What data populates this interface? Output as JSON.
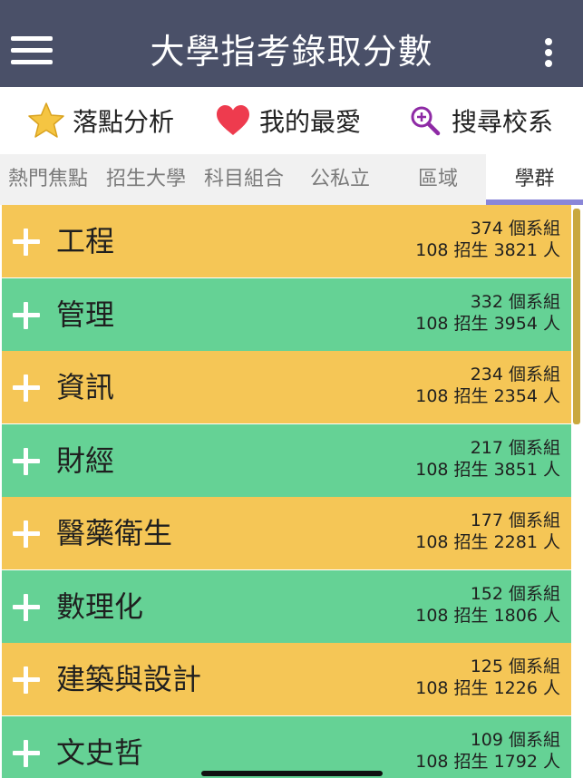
{
  "header": {
    "title": "大學指考錄取分數",
    "menu_icon": "hamburger-icon",
    "more_icon": "kebab-icon"
  },
  "actions": [
    {
      "label": "落點分析",
      "icon": "star-icon"
    },
    {
      "label": "我的最愛",
      "icon": "heart-icon"
    },
    {
      "label": "搜尋校系",
      "icon": "magnifier-plus-icon"
    }
  ],
  "tabs": [
    {
      "label": "熱門焦點"
    },
    {
      "label": "招生大學"
    },
    {
      "label": "科目組合"
    },
    {
      "label": "公私立"
    },
    {
      "label": "區域"
    },
    {
      "label": "學群",
      "active": true
    }
  ],
  "groups": [
    {
      "name": "工程",
      "departments": "374 個系組",
      "enrollment": "108 招生 3821 人"
    },
    {
      "name": "管理",
      "departments": "332 個系組",
      "enrollment": "108 招生 3954 人"
    },
    {
      "name": "資訊",
      "departments": "234 個系組",
      "enrollment": "108 招生 2354 人"
    },
    {
      "name": "財經",
      "departments": "217 個系組",
      "enrollment": "108 招生 3851 人"
    },
    {
      "name": "醫藥衛生",
      "departments": "177 個系組",
      "enrollment": "108 招生 2281 人"
    },
    {
      "name": "數理化",
      "departments": "152 個系組",
      "enrollment": "108 招生 1806 人"
    },
    {
      "name": "建築與設計",
      "departments": "125 個系組",
      "enrollment": "108 招生 1226 人"
    },
    {
      "name": "文史哲",
      "departments": "109 個系組",
      "enrollment": "108 招生 1792 人"
    }
  ],
  "colors": {
    "header_bg": "#4a5068",
    "row_yellow": "#f5c656",
    "row_green": "#65d295",
    "tab_indicator": "#8a86d8",
    "star": "#f5c542",
    "heart": "#ee3b4e",
    "search": "#8e2aa5"
  }
}
